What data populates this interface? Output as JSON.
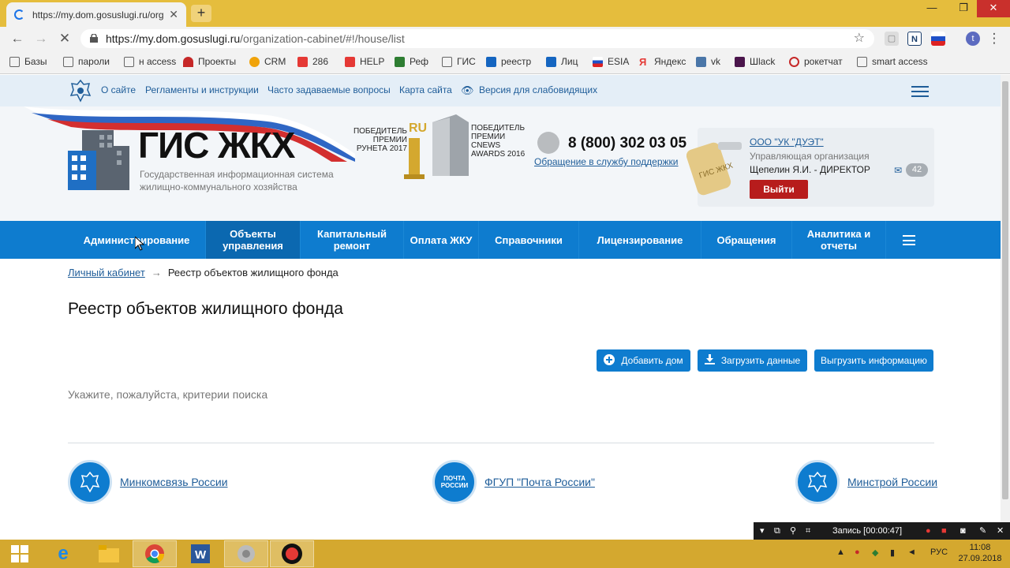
{
  "browser": {
    "tab_title": "https://my.dom.gosuslugi.ru/org",
    "url_host": "https://my.dom.gosuslugi.ru",
    "url_path": "/organization-cabinet/#!/house/list",
    "ext_n": "N",
    "ext_t": "t"
  },
  "bookmarks": [
    "Базы",
    "пароли",
    "н access",
    "Проекты",
    "CRM",
    "286",
    "HELP",
    "Реф",
    "ГИС",
    "реестр",
    "Лиц",
    "ESIA",
    "Яндекс",
    "vk",
    "Шlack",
    "рокетчат",
    "smart access"
  ],
  "topnav": {
    "links": [
      "О сайте",
      "Регламенты и инструкции",
      "Часто задаваемые вопросы",
      "Карта сайта",
      "Версия для слабовидящих"
    ]
  },
  "header": {
    "logo_title": "ГИС ЖКХ",
    "logo_subtitle_1": "Государственная информационная система",
    "logo_subtitle_2": "жилищно-коммунального хозяйства",
    "award1_lines": [
      "ПОБЕДИТЕЛЬ",
      "ПРЕМИИ",
      "РУНЕТА 2017"
    ],
    "award2_lines": [
      "ПОБЕДИТЕЛЬ",
      "ПРЕМИИ",
      "CNEWS",
      "AWARDS 2016"
    ],
    "trophy_label": "RU",
    "phone": "8 (800) 302 03 05",
    "support_link": "Обращение в службу поддержки",
    "key_label": "ГИС ЖКХ",
    "org_name": "ООО \"УК \"ДУЭТ\"",
    "org_type": "Управляющая организация",
    "org_user": "Щепелин Я.И. - ДИРЕКТОР",
    "logout": "Выйти",
    "messages_count": "42"
  },
  "mainnav": {
    "items": [
      {
        "l1": "Администрирование",
        "l2": ""
      },
      {
        "l1": "Объекты",
        "l2": "управления"
      },
      {
        "l1": "Капитальный",
        "l2": "ремонт"
      },
      {
        "l1": "Оплата ЖКУ",
        "l2": ""
      },
      {
        "l1": "Справочники",
        "l2": ""
      },
      {
        "l1": "Лицензирование",
        "l2": ""
      },
      {
        "l1": "Обращения",
        "l2": ""
      },
      {
        "l1": "Аналитика и",
        "l2": "отчеты"
      }
    ]
  },
  "content": {
    "breadcrumb_link": "Личный кабинет",
    "breadcrumb_current": "Реестр объектов жилищного фонда",
    "title": "Реестр объектов жилищного фонда",
    "btn_add": "Добавить дом",
    "btn_upload": "Загрузить данные",
    "btn_export": "Выгрузить информацию",
    "hint": "Укажите, пожалуйста, критерии поиска"
  },
  "footer": {
    "ministry1": "Минкомсвязь России",
    "ministry2": "ФГУП \"Почта России\"",
    "pochta_logo": "ПОЧТА РОССИИ",
    "ministry3": "Минстрой России"
  },
  "recorder": {
    "status": "Запись [00:00:47]"
  },
  "taskbar": {
    "lang": "РУС",
    "time": "11:08",
    "date": "27.09.2018"
  },
  "colors": {
    "accent": "#0e7ccf",
    "logout": "#b71c1c",
    "taskbar": "#d4a82f"
  }
}
